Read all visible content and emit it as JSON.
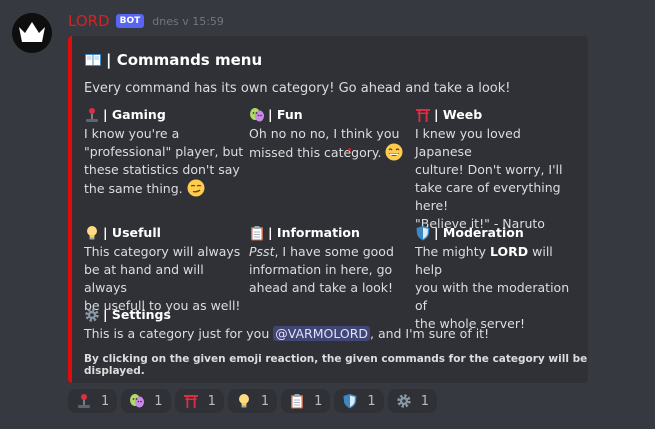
{
  "message": {
    "username": "LORD",
    "bot_tag": "BOT",
    "timestamp": "dnes v 15:59",
    "colors": {
      "username": "#d62222",
      "embed_bar": "#e00b0b",
      "bot_tag": "#5865f2"
    }
  },
  "embed": {
    "title": "| Commands menu",
    "description": "Every command has its own category! Go ahead and take a look!",
    "fields": {
      "gaming": {
        "name": "| Gaming",
        "value": "I know you're a\n\"professional\" player, but\nthese statistics don't say\nthe same thing."
      },
      "fun": {
        "name": "| Fun",
        "value": "Oh no no no, I think you\nmissed this category."
      },
      "weeb": {
        "name": "| Weeb",
        "value": "I knew you loved Japanese\nculture! Don't worry, I'll\ntake care of everything\nhere!\n\"Believe it!\" - Naruto"
      },
      "usefull": {
        "name": "| Usefull",
        "value": "This category will always\nbe at hand and will always\nbe usefull to you as well!"
      },
      "information": {
        "name": "| Information",
        "value_italic": "Psst",
        "value_rest": ", I have some good\ninformation in here, go\nahead and take a look!"
      },
      "moderation": {
        "name": "| Moderation",
        "value_pre": "The mighty ",
        "value_strong": "LORD",
        "value_post": " will help\nyou with the moderation of\nthe whole server!"
      },
      "settings": {
        "name": "| Settings",
        "value_pre": "This is a category just for you ",
        "mention": "@VARMOLORD",
        "value_post": ", and I'm sure of it!"
      }
    },
    "footer": "By clicking on the given emoji reaction, the given commands for the category will be displayed."
  },
  "reactions": [
    {
      "icon": "joystick-icon",
      "count": "1"
    },
    {
      "icon": "performing-arts-icon",
      "count": "1"
    },
    {
      "icon": "torii-gate-icon",
      "count": "1"
    },
    {
      "icon": "light-bulb-icon",
      "count": "1"
    },
    {
      "icon": "clipboard-icon",
      "count": "1"
    },
    {
      "icon": "shield-icon",
      "count": "1"
    },
    {
      "icon": "gear-icon",
      "count": "1"
    }
  ]
}
